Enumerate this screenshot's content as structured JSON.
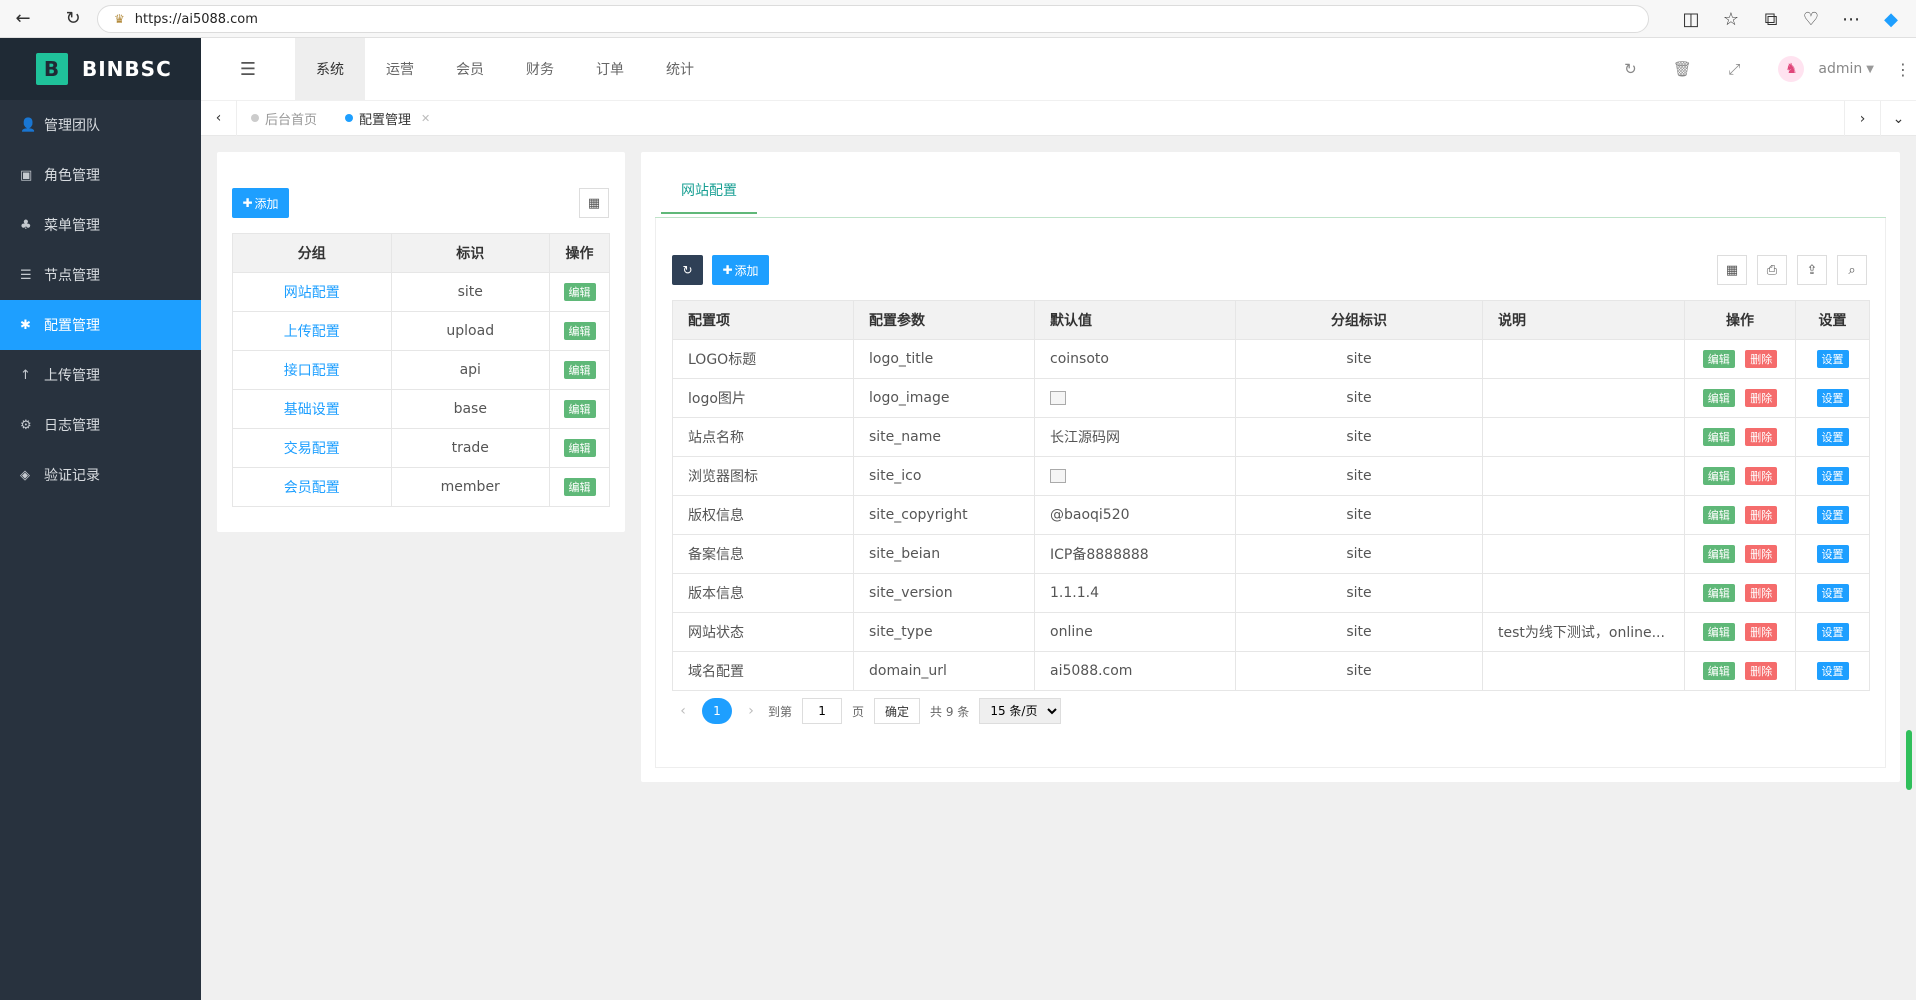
{
  "browser": {
    "url": "https://ai5088.com"
  },
  "sidebar": {
    "brand": "BINBSC",
    "items": [
      {
        "icon": "user-icon",
        "glyph": "👤",
        "label": "管理团队"
      },
      {
        "icon": "role-icon",
        "glyph": "▣",
        "label": "角色管理"
      },
      {
        "icon": "tree-icon",
        "glyph": "♣",
        "label": "菜单管理"
      },
      {
        "icon": "list-icon",
        "glyph": "☰",
        "label": "节点管理"
      },
      {
        "icon": "gear-icon",
        "glyph": "✱",
        "label": "配置管理"
      },
      {
        "icon": "upload-icon",
        "glyph": "↑",
        "label": "上传管理"
      },
      {
        "icon": "log-icon",
        "glyph": "⚙",
        "label": "日志管理"
      },
      {
        "icon": "verify-icon",
        "glyph": "◈",
        "label": "验证记录"
      }
    ]
  },
  "header": {
    "tabs": [
      "系统",
      "运营",
      "会员",
      "财务",
      "订单",
      "统计"
    ],
    "admin": "admin"
  },
  "tabsbar": {
    "home": "后台首页",
    "current": "配置管理"
  },
  "left_panel": {
    "add_label": "添加",
    "columns": [
      "分组",
      "标识",
      "操作"
    ],
    "rows": [
      {
        "group": "网站配置",
        "key": "site",
        "action": "编辑"
      },
      {
        "group": "上传配置",
        "key": "upload",
        "action": "编辑"
      },
      {
        "group": "接口配置",
        "key": "api",
        "action": "编辑"
      },
      {
        "group": "基础设置",
        "key": "base",
        "action": "编辑"
      },
      {
        "group": "交易配置",
        "key": "trade",
        "action": "编辑"
      },
      {
        "group": "会员配置",
        "key": "member",
        "action": "编辑"
      }
    ]
  },
  "right_panel": {
    "tab": "网站配置",
    "add_label": "添加",
    "columns": [
      "配置项",
      "配置参数",
      "默认值",
      "分组标识",
      "说明",
      "操作",
      "设置"
    ],
    "rows": [
      {
        "name": "LOGO标题",
        "param": "logo_title",
        "value": "coinsoto",
        "value_is_image": false,
        "group": "site",
        "desc": "",
        "edit": "编辑",
        "del": "删除",
        "set": "设置"
      },
      {
        "name": "logo图片",
        "param": "logo_image",
        "value": "",
        "value_is_image": true,
        "group": "site",
        "desc": "",
        "edit": "编辑",
        "del": "删除",
        "set": "设置"
      },
      {
        "name": "站点名称",
        "param": "site_name",
        "value": "长江源码网",
        "value_is_image": false,
        "group": "site",
        "desc": "",
        "edit": "编辑",
        "del": "删除",
        "set": "设置"
      },
      {
        "name": "浏览器图标",
        "param": "site_ico",
        "value": "",
        "value_is_image": true,
        "group": "site",
        "desc": "",
        "edit": "编辑",
        "del": "删除",
        "set": "设置"
      },
      {
        "name": "版权信息",
        "param": "site_copyright",
        "value": "@baoqi520",
        "value_is_image": false,
        "group": "site",
        "desc": "",
        "edit": "编辑",
        "del": "删除",
        "set": "设置"
      },
      {
        "name": "备案信息",
        "param": "site_beian",
        "value": "ICP备8888888",
        "value_is_image": false,
        "group": "site",
        "desc": "",
        "edit": "编辑",
        "del": "删除",
        "set": "设置"
      },
      {
        "name": "版本信息",
        "param": "site_version",
        "value": "1.1.1.4",
        "value_is_image": false,
        "group": "site",
        "desc": "",
        "edit": "编辑",
        "del": "删除",
        "set": "设置"
      },
      {
        "name": "网站状态",
        "param": "site_type",
        "value": "online",
        "value_is_image": false,
        "group": "site",
        "desc": "test为线下测试，online...",
        "edit": "编辑",
        "del": "删除",
        "set": "设置"
      },
      {
        "name": "域名配置",
        "param": "domain_url",
        "value": "ai5088.com",
        "value_is_image": false,
        "group": "site",
        "desc": "",
        "edit": "编辑",
        "del": "删除",
        "set": "设置"
      }
    ],
    "pager": {
      "current": "1",
      "goto_label": "到第",
      "goto_value": "1",
      "page_unit": "页",
      "confirm": "确定",
      "total": "共 9 条",
      "per_page": "15 条/页"
    }
  },
  "colors": {
    "accent": "#1e9fff",
    "sidebar": "#28323e",
    "green": "#5fb878",
    "red": "#f56c6c"
  }
}
